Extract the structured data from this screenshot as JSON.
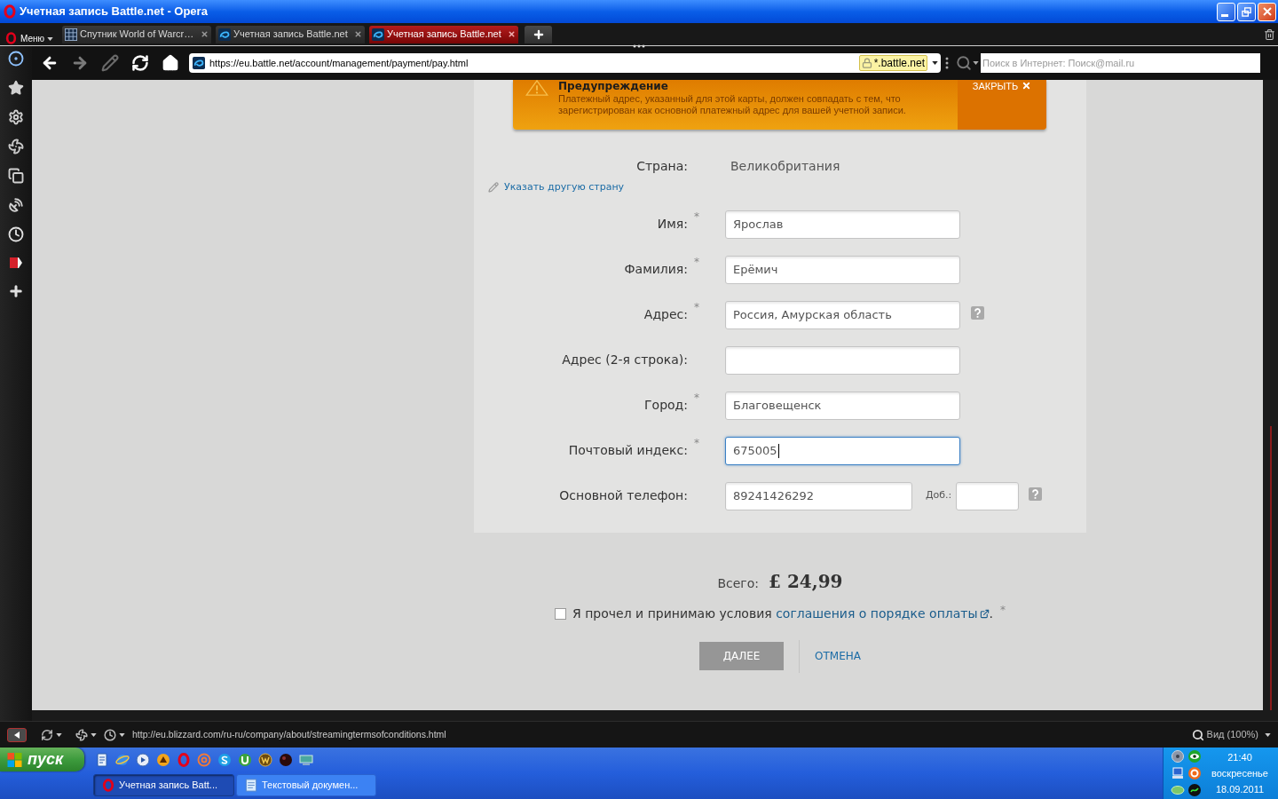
{
  "window": {
    "title": "Учетная запись Battle.net - Opera"
  },
  "menu_button": {
    "label": "Меню"
  },
  "tabs": [
    {
      "kind": "grid",
      "label": "Спутник World of Warcr…",
      "selected": false
    },
    {
      "kind": "site",
      "label": "Учетная запись Battle.net",
      "selected": false
    },
    {
      "kind": "site",
      "label": "Учетная запись Battle.net",
      "selected": true
    }
  ],
  "address_bar": {
    "url": "https://eu.battle.net/account/management/payment/pay.html",
    "security_badge": "*.battle.net"
  },
  "search": {
    "placeholder": "Поиск в Интернет: Поиск@mail.ru"
  },
  "warning": {
    "title": "Предупреждение",
    "text": "Платежный адрес, указанный для этой карты, должен совпадать с тем, что зарегистрирован как основной платежный адрес для вашей учетной записи.",
    "close_label": "ЗАКРЫТЬ"
  },
  "country": {
    "label": "Страна:",
    "value": "Великобритания",
    "change_link": "Указать другую страну"
  },
  "fields": [
    {
      "kind": "text",
      "label": "Имя:",
      "required_mark": "*",
      "value": "Ярослав",
      "focused": false,
      "help": false
    },
    {
      "kind": "text",
      "label": "Фамилия:",
      "required_mark": "*",
      "value": "Ерёмич",
      "focused": false,
      "help": false
    },
    {
      "kind": "text",
      "label": "Адрес:",
      "required_mark": "*",
      "value": "Россия, Амурская область",
      "focused": false,
      "help": true
    },
    {
      "kind": "text",
      "label": "Адрес (2-я строка):",
      "focused": false,
      "help": false
    },
    {
      "kind": "text",
      "label": "Город:",
      "required_mark": "*",
      "value": "Благовещенск",
      "focused": false,
      "help": false
    },
    {
      "kind": "text",
      "label": "Почтовый индекс:",
      "required_mark": "*",
      "value": "675005",
      "focused": true,
      "help": false
    },
    {
      "kind": "phone",
      "label": "Основной телефон:",
      "value": "89241426292",
      "ext_label": "Доб.:",
      "focused": false,
      "help": true
    }
  ],
  "total": {
    "label": "Всего:",
    "amount": "£ 24,99"
  },
  "agreement": {
    "checked": false,
    "text": "Я прочел и принимаю условия",
    "link": "соглашения о порядке оплаты",
    "end": ".",
    "required_mark": "*"
  },
  "buttons": [
    {
      "kind": "primary",
      "label": "ДАЛЕЕ",
      "disabled": true
    },
    {
      "kind": "link",
      "label": "ОТМЕНА",
      "disabled": false
    }
  ],
  "status_bar": {
    "url": "http://eu.blizzard.com/ru-ru/company/about/streamingtermsofconditions.html",
    "zoom": "Вид (100%)"
  },
  "taskbar": {
    "start_label": "пуск",
    "tasks": [
      {
        "kind": "browser",
        "label": "Учетная запись Batt...",
        "selected": true
      },
      {
        "kind": "notepad",
        "label": "Текстовый докумен...",
        "selected": false
      }
    ],
    "clock": {
      "time": "21:40",
      "day": "воскресенье",
      "date": "18.09.2011"
    }
  }
}
